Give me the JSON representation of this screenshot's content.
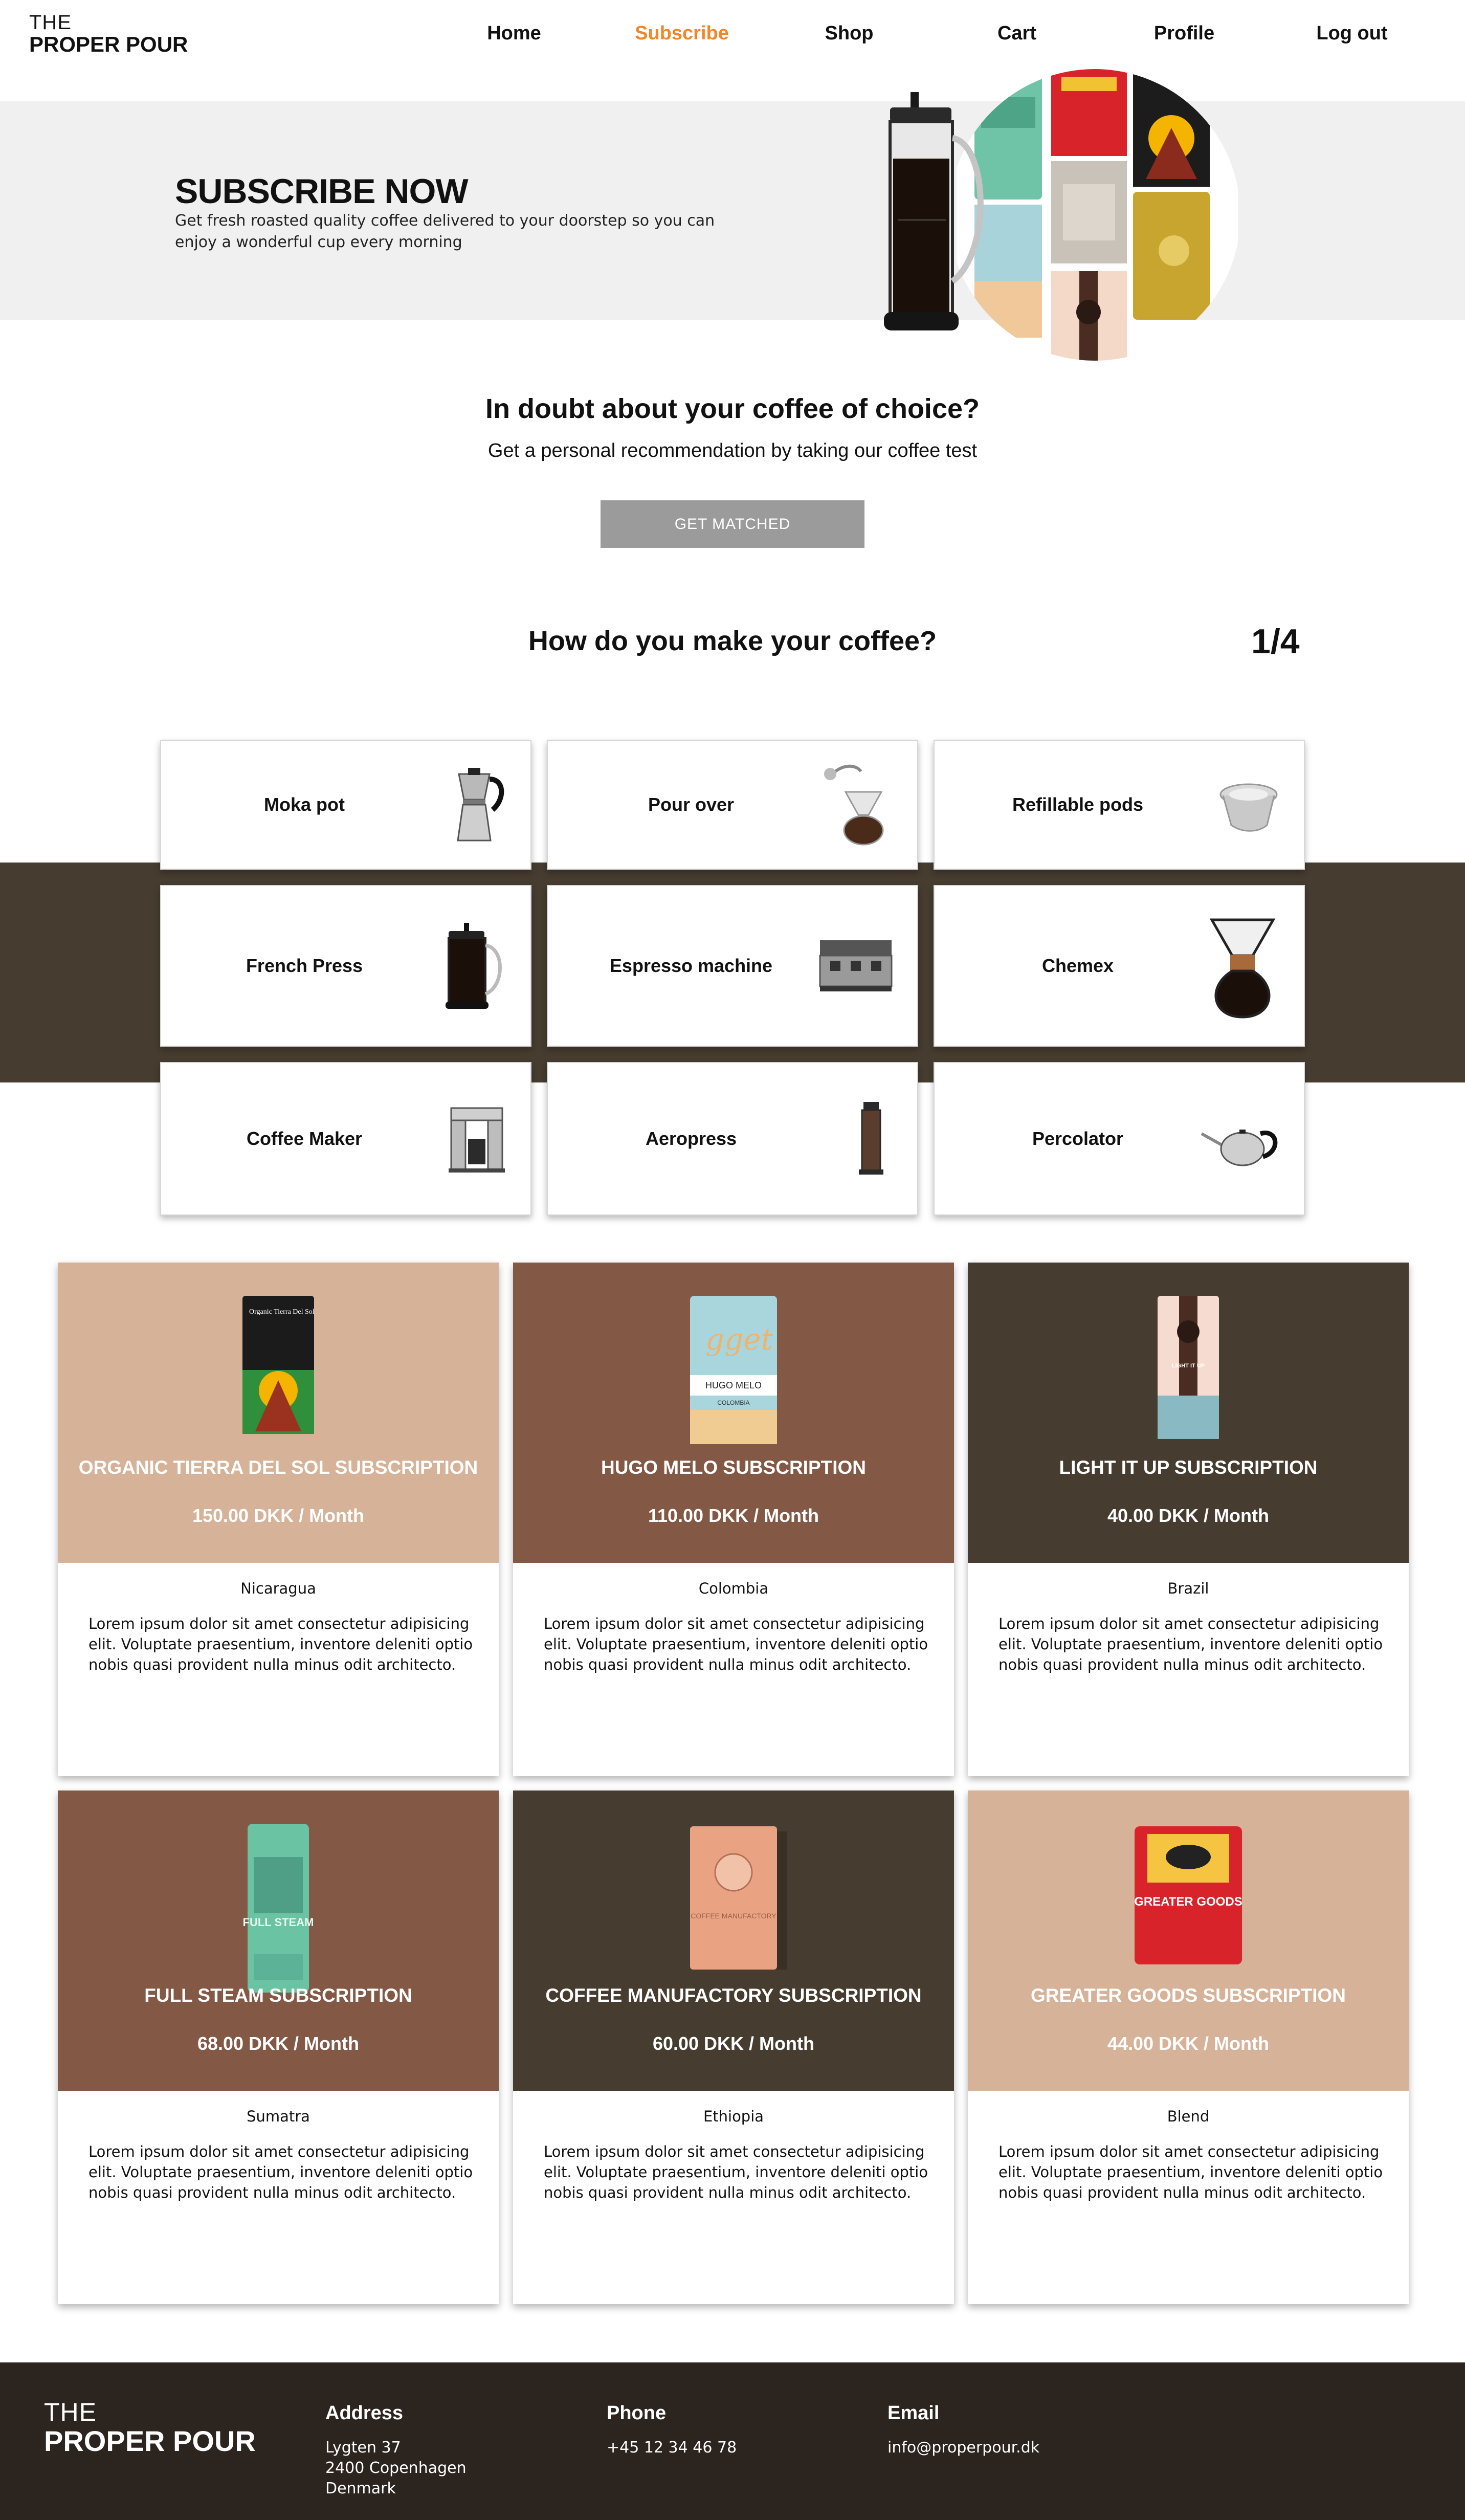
{
  "brand": {
    "line1": "THE",
    "line2": "PROPER POUR"
  },
  "nav": [
    {
      "label": "Home",
      "active": false
    },
    {
      "label": "Subscribe",
      "active": true
    },
    {
      "label": "Shop",
      "active": false
    },
    {
      "label": "Cart",
      "active": false
    },
    {
      "label": "Profile",
      "active": false
    },
    {
      "label": "Log out",
      "active": false
    }
  ],
  "hero": {
    "title": "SUBSCRIBE NOW",
    "subtitle": "Get fresh roasted quality coffee delivered to your doorstep so you can enjoy a wonderful cup every morning"
  },
  "doubt": {
    "title": "In doubt about your coffee of choice?",
    "subtitle": "Get a personal recommendation by taking our coffee test",
    "button": "GET MATCHED"
  },
  "question": {
    "title": "How do you make your coffee?",
    "step": "1/4"
  },
  "methods": [
    {
      "label": "Moka pot",
      "icon": "moka-pot-icon"
    },
    {
      "label": "Pour over",
      "icon": "pour-over-icon"
    },
    {
      "label": "Refillable pods",
      "icon": "pod-icon"
    },
    {
      "label": "French Press",
      "icon": "french-press-icon"
    },
    {
      "label": "Espresso machine",
      "icon": "espresso-machine-icon"
    },
    {
      "label": "Chemex",
      "icon": "chemex-icon"
    },
    {
      "label": "Coffee Maker",
      "icon": "coffee-maker-icon"
    },
    {
      "label": "Aeropress",
      "icon": "aeropress-icon"
    },
    {
      "label": "Percolator",
      "icon": "kettle-icon"
    }
  ],
  "subscriptions": [
    {
      "name": "ORGANIC TIERRA DEL SOL SUBSCRIPTION",
      "price": "150.00 DKK / Month",
      "origin": "Nicaragua",
      "description": "Lorem ipsum dolor sit amet consectetur adipisicing elit. Voluptate praesentium, inventore deleniti optio nobis quasi provident nulla minus odit architecto.",
      "bg": "#d6b398"
    },
    {
      "name": "HUGO MELO SUBSCRIPTION",
      "price": "110.00 DKK / Month",
      "origin": "Colombia",
      "description": "Lorem ipsum dolor sit amet consectetur adipisicing elit. Voluptate praesentium, inventore deleniti optio nobis quasi provident nulla minus odit architecto.",
      "bg": "#835845"
    },
    {
      "name": "LIGHT IT UP SUBSCRIPTION",
      "price": "40.00 DKK / Month",
      "origin": "Brazil",
      "description": "Lorem ipsum dolor sit amet consectetur adipisicing elit. Voluptate praesentium, inventore deleniti optio nobis quasi provident nulla minus odit architecto.",
      "bg": "#463c30"
    },
    {
      "name": "FULL STEAM SUBSCRIPTION",
      "price": "68.00 DKK / Month",
      "origin": "Sumatra",
      "description": "Lorem ipsum dolor sit amet consectetur adipisicing elit. Voluptate praesentium, inventore deleniti optio nobis quasi provident nulla minus odit architecto.",
      "bg": "#835845"
    },
    {
      "name": "COFFEE MANUFACTORY SUBSCRIPTION",
      "price": "60.00 DKK / Month",
      "origin": "Ethiopia",
      "description": "Lorem ipsum dolor sit amet consectetur adipisicing elit. Voluptate praesentium, inventore deleniti optio nobis quasi provident nulla minus odit architecto.",
      "bg": "#463c30"
    },
    {
      "name": "GREATER GOODS SUBSCRIPTION",
      "price": "44.00 DKK / Month",
      "origin": "Blend",
      "description": "Lorem ipsum dolor sit amet consectetur adipisicing elit. Voluptate praesentium, inventore deleniti optio nobis quasi provident nulla minus odit architecto.",
      "bg": "#d6b398"
    }
  ],
  "bag_labels": {
    "tierra": "Organic Tierra Del Sol",
    "hugo_brand": "HUGO MELO",
    "hugo_origin": "COLOMBIA",
    "hugo_script": "gget",
    "light": "LIGHT IT UP",
    "full_steam": "FULL STEAM",
    "manufactory": "COFFEE MANUFACTORY",
    "greater_goods": "GREATER GOODS"
  },
  "footer": {
    "brand": {
      "line1": "THE",
      "line2": "PROPER POUR"
    },
    "address": {
      "heading": "Address",
      "line1": "Lygten 37",
      "line2": "2400 Copenhagen",
      "line3": "Denmark"
    },
    "phone": {
      "heading": "Phone",
      "value": "+45 12 34 46 78"
    },
    "email": {
      "heading": "Email",
      "value": "info@properpour.dk"
    }
  }
}
